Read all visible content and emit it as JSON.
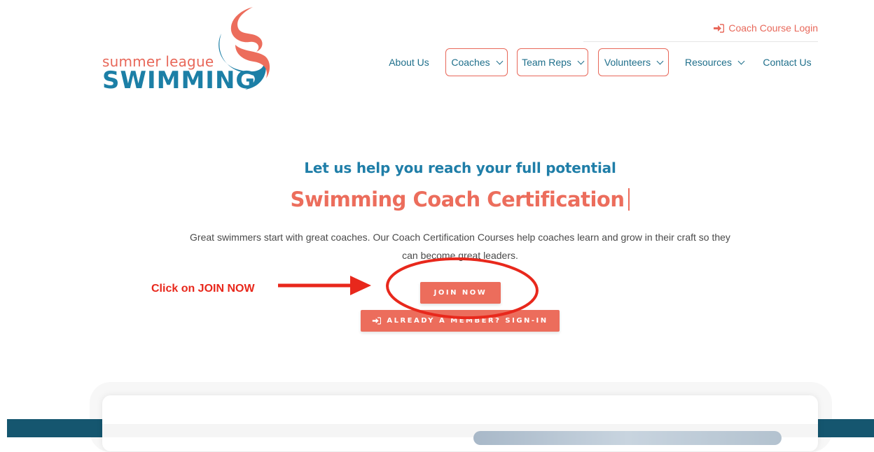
{
  "logo": {
    "line1": "summer league",
    "line2": "SWIMMING",
    "icon": "swimmer-swirl-logo"
  },
  "top_link": {
    "icon": "sign-in-icon",
    "label": "Coach Course Login"
  },
  "nav": {
    "items": [
      {
        "label": "About Us",
        "dropdown": false,
        "boxed": false
      },
      {
        "label": "Coaches",
        "dropdown": true,
        "boxed": true
      },
      {
        "label": "Team Reps",
        "dropdown": true,
        "boxed": true
      },
      {
        "label": "Volunteers",
        "dropdown": true,
        "boxed": true
      },
      {
        "label": "Resources",
        "dropdown": true,
        "boxed": false
      },
      {
        "label": "Contact Us",
        "dropdown": false,
        "boxed": false
      }
    ]
  },
  "hero": {
    "subtitle": "Let us help you reach your full potential",
    "title": "Swimming Coach Certification",
    "description": "Great swimmers start with great coaches. Our Coach Certification Courses help coaches learn and grow in their craft so they can become great leaders.",
    "join_label": "JOIN NOW",
    "signin_label": "ALREADY A MEMBER? SIGN-IN"
  },
  "annotation": {
    "text": "Click on JOIN NOW"
  },
  "colors": {
    "coral": "#ec6d5c",
    "blue": "#1f7ea8",
    "navy": "#15566f",
    "annotation_red": "#e8281c"
  }
}
